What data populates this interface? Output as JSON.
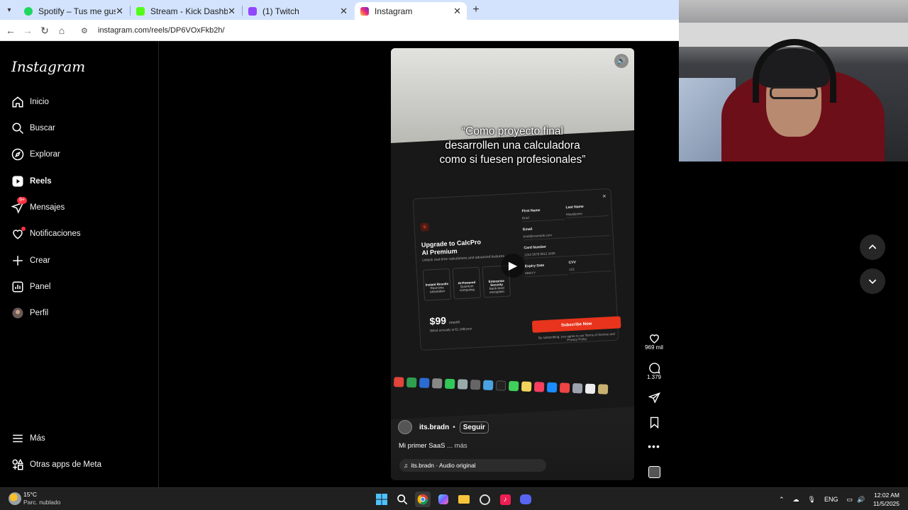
{
  "browser": {
    "tabs": [
      {
        "title": "Spotify – Tus me gusta",
        "favicon_color": "#1ed760"
      },
      {
        "title": "Stream - Kick Dashboard",
        "favicon_color": "#53fc18"
      },
      {
        "title": "(1) Twitch",
        "favicon_color": "#9146ff"
      },
      {
        "title": "Instagram",
        "favicon_color": "#e1306c",
        "active": true
      }
    ],
    "url": "instagram.com/reels/DP6VOxFkb2h/"
  },
  "sidebar": {
    "logo": "Instagram",
    "items": [
      {
        "label": "Inicio",
        "icon": "home-icon"
      },
      {
        "label": "Buscar",
        "icon": "search-icon"
      },
      {
        "label": "Explorar",
        "icon": "compass-icon"
      },
      {
        "label": "Reels",
        "icon": "reels-icon",
        "active": true
      },
      {
        "label": "Mensajes",
        "icon": "messenger-icon",
        "badge": "9+"
      },
      {
        "label": "Notificaciones",
        "icon": "heart-icon",
        "dot": true
      },
      {
        "label": "Crear",
        "icon": "plus-icon"
      },
      {
        "label": "Panel",
        "icon": "chart-icon"
      },
      {
        "label": "Perfil",
        "icon": "avatar-icon"
      }
    ],
    "bottom_items": [
      {
        "label": "Más",
        "icon": "menu-icon"
      },
      {
        "label": "Otras apps de Meta",
        "icon": "meta-apps-icon"
      }
    ]
  },
  "reel": {
    "overlay_text_lines": [
      "“Como proyecto final",
      "desarrollen una calculadora",
      "como si fuesen profesionales”"
    ],
    "video_modal": {
      "title_line1": "Upgrade to CalcPro",
      "title_line2": "AI Premium",
      "subtitle": "Unlock real-time calculations and advanced features",
      "features": [
        {
          "title": "Instant Results",
          "sub": "Real-time calculation"
        },
        {
          "title": "AI-Powered",
          "sub": "Quantum computing"
        },
        {
          "title": "Enterprise Security",
          "sub": "Bank-level encryption"
        }
      ],
      "price": "$99",
      "price_unit": "/month",
      "billed": "Billed annually at $1,188/year",
      "fields": [
        {
          "label": "First Name",
          "value": "Brad"
        },
        {
          "label": "Last Name",
          "value": "Mayeljones"
        },
        {
          "label": "Email",
          "value": "brad@example.com"
        },
        {
          "label": "Card Number",
          "value": "1234 5678 9012 3456"
        },
        {
          "label": "Expiry Date",
          "value": "MM/YY"
        },
        {
          "label": "CVV",
          "value": "123"
        }
      ],
      "subscribe": "Subscribe Now",
      "terms": "By subscribing, you agree to our Terms of Service and Privacy Policy"
    },
    "author": "its.bradn",
    "author_sep": "•",
    "follow": "Seguir",
    "caption": "Mi primer SaaS",
    "caption_more": "... más",
    "audio": "its.bradn · Audio original"
  },
  "actions": {
    "likes": "969 mil",
    "comments": "1.379"
  },
  "taskbar": {
    "temperature": "15°C",
    "condition": "Parc. nublado",
    "language": "ENG",
    "time": "12:02 AM",
    "date": "11/5/2025"
  }
}
